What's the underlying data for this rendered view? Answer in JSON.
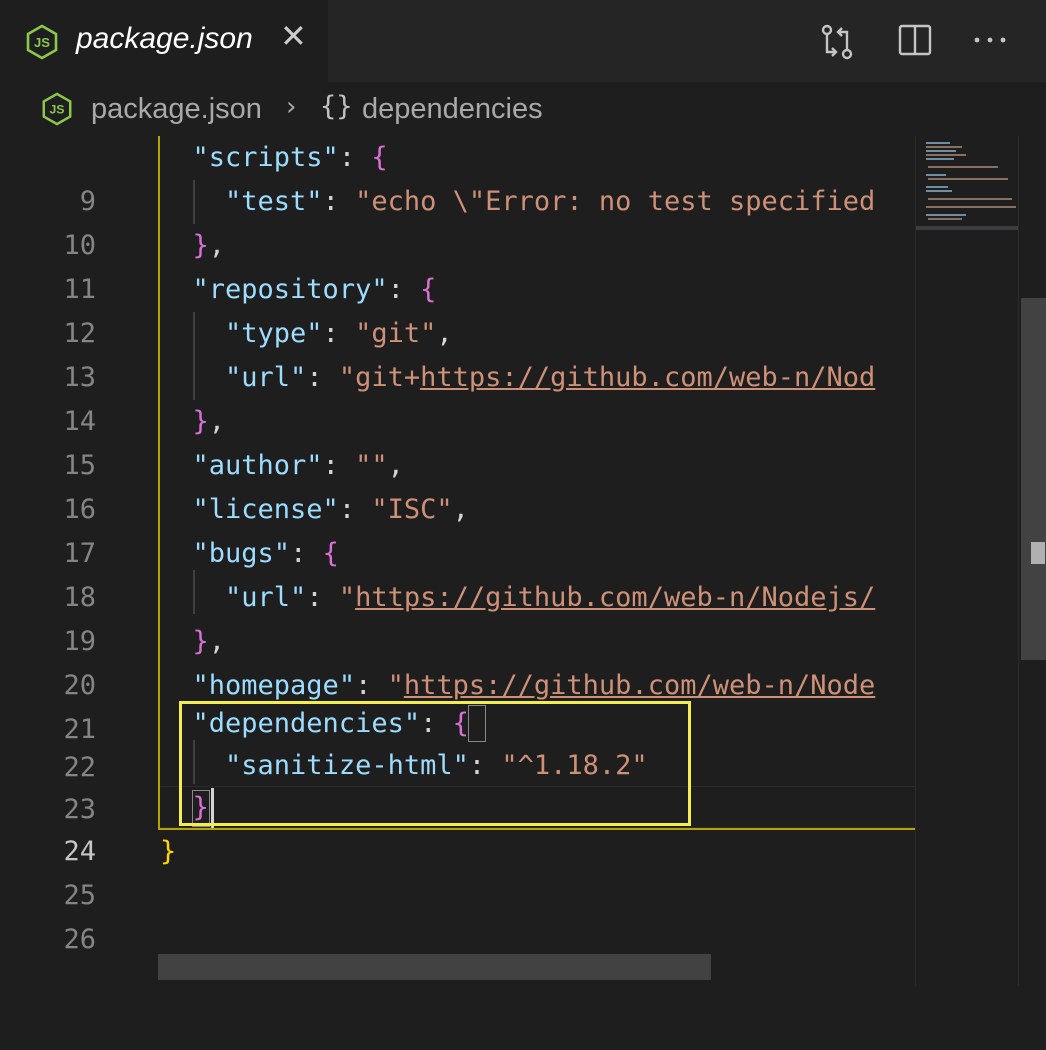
{
  "tab": {
    "title": "package.json",
    "close_glyph": "✕",
    "icon": "nodejs-icon"
  },
  "actions": {
    "compare_icon": "git-compare-icon",
    "split_icon": "split-editor-icon",
    "more_icon": "more-actions-icon"
  },
  "breadcrumb": {
    "file": "package.json",
    "separator": "›",
    "braces": "{}",
    "node": "dependencies"
  },
  "editor": {
    "active_line": 24,
    "lines": [
      {
        "n": "9"
      },
      {
        "n": "10"
      },
      {
        "n": "11"
      },
      {
        "n": "12"
      },
      {
        "n": "13"
      },
      {
        "n": "14"
      },
      {
        "n": "15"
      },
      {
        "n": "16"
      },
      {
        "n": "17"
      },
      {
        "n": "18"
      },
      {
        "n": "19"
      },
      {
        "n": "20"
      },
      {
        "n": "21"
      },
      {
        "n": "22"
      },
      {
        "n": "23"
      },
      {
        "n": "24"
      },
      {
        "n": "25"
      },
      {
        "n": "26"
      }
    ],
    "code": {
      "l9_key": "\"scripts\"",
      "l10_key": "\"test\"",
      "l10_val": "\"echo \\\"Error: no test specified",
      "l12_key": "\"repository\"",
      "l13_key": "\"type\"",
      "l13_val": "\"git\"",
      "l14_key": "\"url\"",
      "l14_val_prefix": "\"git+",
      "l14_val_link": "https://github.com/web-n/Nod",
      "l16_key": "\"author\"",
      "l16_val": "\"\"",
      "l17_key": "\"license\"",
      "l17_val": "\"ISC\"",
      "l18_key": "\"bugs\"",
      "l19_key": "\"url\"",
      "l19_val_prefix": "\"",
      "l19_val_link": "https://github.com/web-n/Nodejs/",
      "l21_key": "\"homepage\"",
      "l21_val_prefix": "\"",
      "l21_val_link": "https://github.com/web-n/Node",
      "l22_key": "\"dependencies\"",
      "l23_key": "\"sanitize-html\"",
      "l23_val": "\"^1.18.2\"",
      "colon": ": ",
      "comma": ",",
      "open_brace": "{",
      "close_brace": "}"
    }
  },
  "colors": {
    "highlight_box": "#f2ee4d",
    "json_key": "#9cdcfe",
    "json_string": "#ce9178",
    "bracket_level1": "#ffd700",
    "bracket_level2": "#da70d6",
    "nodejs_green": "#8cc84b"
  }
}
